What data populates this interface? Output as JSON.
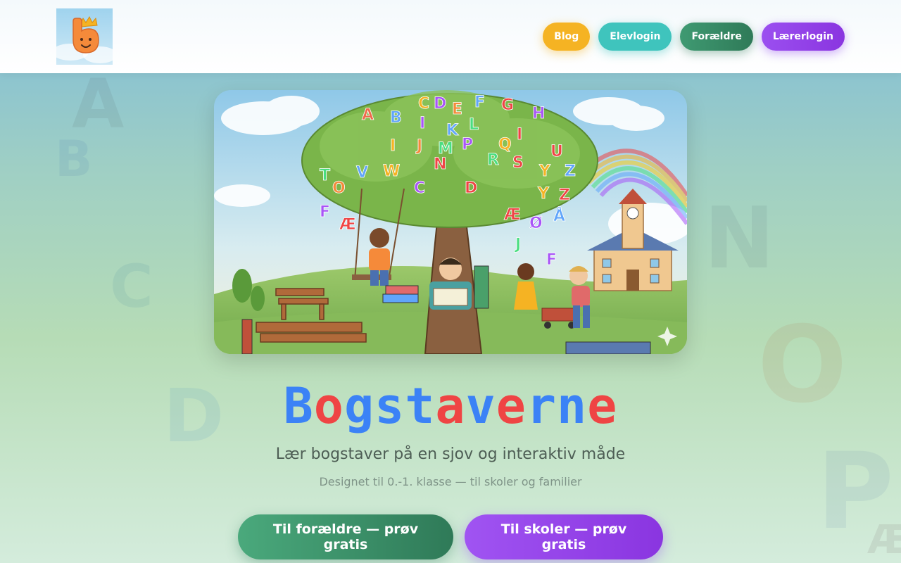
{
  "nav": {
    "blog": "Blog",
    "student_login": "Elevlogin",
    "parents": "Forældre",
    "teacher_login": "Lærerlogin"
  },
  "hero": {
    "title_letters": [
      "B",
      "o",
      "g",
      "s",
      "t",
      "a",
      "v",
      "e",
      "r",
      "n",
      "e"
    ],
    "title_colors": [
      "#3b82f6",
      "#ef4444",
      "#3b82f6",
      "#3b82f6",
      "#3b82f6",
      "#ef4444",
      "#3b82f6",
      "#ef4444",
      "#3b82f6",
      "#3b82f6",
      "#ef4444"
    ],
    "subtitle": "Lær bogstaver på en sjov og interaktiv måde",
    "tagline": "Designet til 0.-1. klasse — til skoler og familier"
  },
  "cta": {
    "parents": "Til forældre — prøv gratis",
    "schools": "Til skoler — prøv gratis"
  },
  "colors": {
    "blog": "#f5b323",
    "student": "#3fc4bd",
    "parents": "#2f7a58",
    "teacher": "#8a35e0"
  }
}
